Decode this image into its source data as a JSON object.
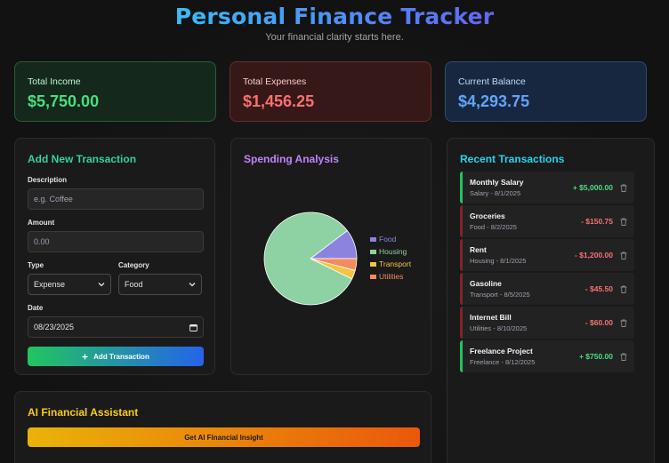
{
  "header": {
    "title": "Personal Finance Tracker",
    "subtitle": "Your financial clarity starts here."
  },
  "summary": {
    "income_label": "Total Income",
    "income_value": "$5,750.00",
    "expense_label": "Total Expenses",
    "expense_value": "$1,456.25",
    "balance_label": "Current Balance",
    "balance_value": "$4,293.75"
  },
  "form": {
    "title": "Add New Transaction",
    "description_label": "Description",
    "description_placeholder": "e.g. Coffee",
    "amount_label": "Amount",
    "amount_placeholder": "0.00",
    "type_label": "Type",
    "type_value": "Expense",
    "category_label": "Category",
    "category_value": "Food",
    "date_label": "Date",
    "date_value": "08/23/2025",
    "submit_label": "Add Transaction"
  },
  "chart": {
    "title": "Spending Analysis"
  },
  "chart_data": {
    "type": "pie",
    "categories": [
      "Food",
      "Housing",
      "Transport",
      "Utilities"
    ],
    "values": [
      150.75,
      1200.0,
      45.5,
      60.0
    ],
    "colors": [
      "#8b83de",
      "#8ed1a3",
      "#f6c445",
      "#f58b5c"
    ],
    "legend_position": "right"
  },
  "transactions": {
    "title": "Recent Transactions",
    "items": [
      {
        "name": "Monthly Salary",
        "meta": "Salary - 8/1/2025",
        "amount": "+ $5,000.00",
        "kind": "income"
      },
      {
        "name": "Groceries",
        "meta": "Food - 8/2/2025",
        "amount": "- $150.75",
        "kind": "expense"
      },
      {
        "name": "Rent",
        "meta": "Housing - 8/1/2025",
        "amount": "- $1,200.00",
        "kind": "expense"
      },
      {
        "name": "Gasoline",
        "meta": "Transport - 8/5/2025",
        "amount": "- $45.50",
        "kind": "expense"
      },
      {
        "name": "Internet Bill",
        "meta": "Utilities - 8/10/2025",
        "amount": "- $60.00",
        "kind": "expense"
      },
      {
        "name": "Freelance Project",
        "meta": "Freelance - 8/12/2025",
        "amount": "+ $750.00",
        "kind": "income"
      }
    ]
  },
  "ai": {
    "title": "AI Financial Assistant",
    "button_label": "Get AI Financial Insight"
  },
  "icons": {
    "delete": "trash-icon",
    "add": "plus-icon",
    "select": "chevron-down-icon",
    "calendar": "calendar-icon"
  }
}
